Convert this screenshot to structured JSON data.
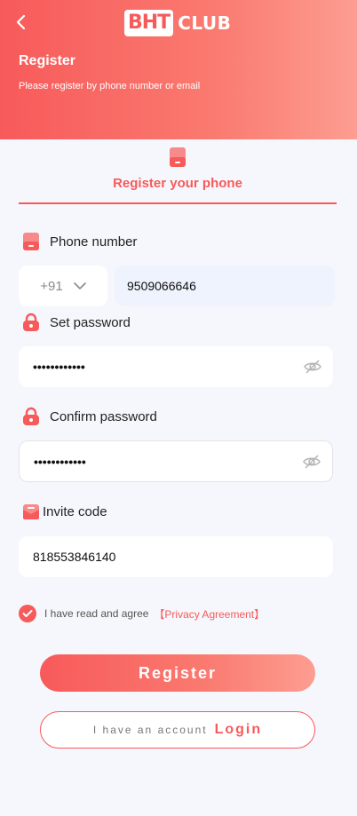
{
  "header": {
    "logo_badge": "BHT",
    "logo_club": "CLUB",
    "title": "Register",
    "subtitle": "Please register by phone number or email"
  },
  "tab": {
    "label": "Register your phone"
  },
  "phone": {
    "label": "Phone number",
    "country_code": "+91",
    "value": "9509066646"
  },
  "password": {
    "label": "Set password",
    "value": "••••••••••••"
  },
  "confirm_password": {
    "label": "Confirm password",
    "value": "••••••••••••"
  },
  "invite": {
    "label": "Invite code",
    "value": "818553846140"
  },
  "agreement": {
    "checked": true,
    "text": "I have read and agree",
    "link": "【Privacy Agreement】"
  },
  "buttons": {
    "register": "Register",
    "have_account": "I have an account",
    "login": "Login"
  },
  "colors": {
    "accent": "#f75a5a",
    "background": "#f6f7fc"
  }
}
